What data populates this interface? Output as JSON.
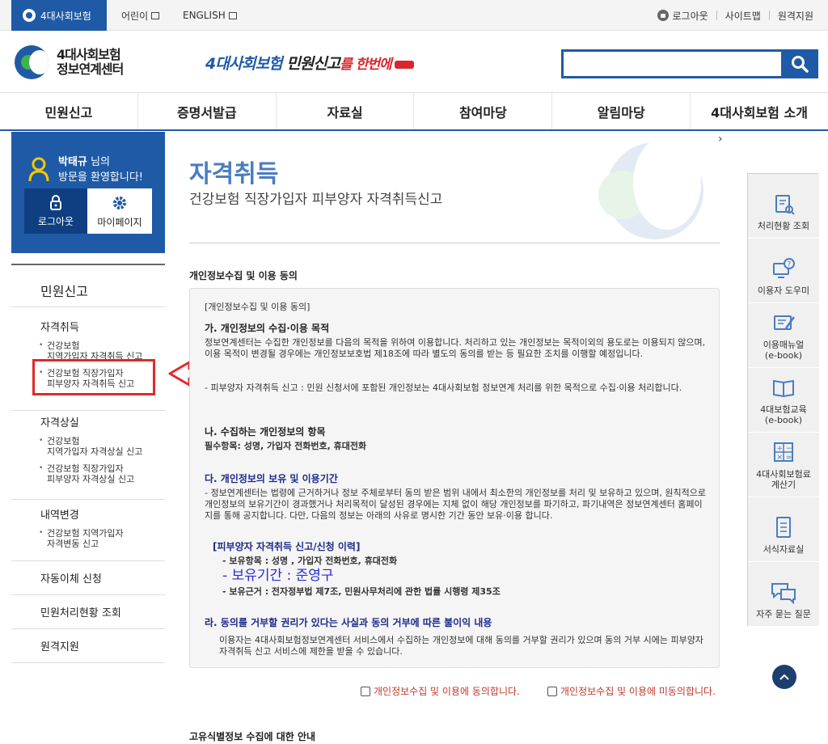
{
  "topbar": {
    "main_tab": "4대사회보험",
    "kids_link": "어린이",
    "english_link": "ENGLISH",
    "logout": "로그아웃",
    "sitemap": "사이트맵",
    "remote": "원격지원"
  },
  "header": {
    "brand_line1": "4대사회보험",
    "brand_line2": "정보연계센터",
    "slogan_part1": "4대사회보험",
    "slogan_part2": " 민원신고",
    "slogan_part3": "를 한번에",
    "search_placeholder": ""
  },
  "gnb": {
    "items": [
      "민원신고",
      "증명서발급",
      "자료실",
      "참여마당",
      "알림마당",
      "4대사회보험 소개"
    ]
  },
  "welcome": {
    "user_name": "박태규",
    "suffix": " 님의",
    "line2": "방문을 환영합니다!",
    "logout_btn": "로그아웃",
    "mypage_btn": "마이페이지"
  },
  "lnb": {
    "title": "민원신고",
    "groups": [
      {
        "title": "자격취득",
        "subs": [
          {
            "l1": "건강보험",
            "l2": "지역가입자 자격취득 신고"
          },
          {
            "l1": "건강보험 직장가입자",
            "l2": "피부양자 자격취득 신고"
          }
        ]
      },
      {
        "title": "자격상실",
        "subs": [
          {
            "l1": "건강보험",
            "l2": "지역가입자 자격상실 신고"
          },
          {
            "l1": "건강보험 직장가입자",
            "l2": "피부양자 자격상실 신고"
          }
        ]
      },
      {
        "title": "내역변경",
        "subs": [
          {
            "l1": "건강보험 지역가입자",
            "l2": "자격변동 신고"
          }
        ]
      }
    ],
    "flat": [
      "자동이체 신청",
      "민원처리현황 조회",
      "원격지원"
    ]
  },
  "content": {
    "title": "자격취득",
    "subtitle": "건강보험 직장가입자 피부양자 자격취득신고",
    "section1": "개인정보수집 및 이용 동의",
    "box_header": "[개인정보수집 및 이용 동의]",
    "ga_title": "가. 개인정보의 수집·이용 목적",
    "ga_body": "정보연계센터는 수집한 개인정보를 다음의 목적을 위하여 이용합니다. 처리하고 있는 개인정보는 목적이외의 용도로는 이용되지 않으며, 이용 목적이 변경될 경우에는 개인정보보호법 제18조에 따라 별도의 동의를 받는 등 필요한 조치를 이행할 예정입니다.",
    "ga_item": "- 피부양자 자격취득 신고 : 민원 신청서에 포함된 개인정보는 4대사회보험 정보연계 처리를 위한 목적으로 수집·이용 처리합니다.",
    "na_title": "나. 수집하는 개인정보의 항목",
    "na_body": "필수항목: 성명, 가입자 전화번호, 휴대전화",
    "da_title": "다. 개인정보의 보유 및 이용기간",
    "da_body": "- 정보연계센터는 법령에 근거하거나 정보 주체로부터 동의 받은 범위 내에서 최소한의 개인정보를 처리 및 보유하고 있으며, 원칙적으로 개인정보의 보유기간이 경과했거나 처리목적이 달성된 경우에는 지체 없이 해당 개인정보를 파기하고, 파기내역은 정보연계센터 홈페이지를 통해 공지합니다. 다만, 다음의 정보는 아래의 사유로 명시한 기간 동안 보유·이용 합니다.",
    "record_title": "[피부양자 자격취득 신고/신청 이력]",
    "record_item1": "- 보유항목 : 성명 , 가입자 전화번호, 휴대전화",
    "record_item2": "- 보유기간 : 준영구",
    "record_item3": "- 보유근거 : 전자정부법 제7조, 민원사무처리에 관한 법률 시행령 제35조",
    "ra_title": "라. 동의를 거부할 권리가 있다는 사실과 동의 거부에 따른 불이익 내용",
    "ra_body": "이용자는 4대사회보험정보연계센터 서비스에서 수집하는 개인정보에 대해 동의를 거부할 권리가 있으며 동의 거부 시에는 피부양자 자격취득 신고 서비스에 제한을 받을 수 있습니다.",
    "agree_label": "개인정보수집 및 이용에 동의합니다.",
    "disagree_label": "개인정보수집 및 이용에 미동의합니다.",
    "section2": "고유식별정보 수집에 대한 안내"
  },
  "quick": {
    "items": [
      {
        "label": "처리현황 조회",
        "icon": "clipboard-search-icon"
      },
      {
        "label": "이용자 도우미",
        "icon": "help-monitor-icon"
      },
      {
        "label": "이용매뉴얼\n(e-book)",
        "icon": "manual-edit-icon"
      },
      {
        "label": "4대보험교육\n(e-book)",
        "icon": "book-icon"
      },
      {
        "label": "4대사회보험료\n계산기",
        "icon": "calculator-icon"
      },
      {
        "label": "서식자료실",
        "icon": "document-icon"
      },
      {
        "label": "자주 묻는 질문",
        "icon": "faq-bubble-icon"
      }
    ]
  },
  "colors": {
    "brand_blue": "#1f5aa6",
    "highlight_red": "#e12a2a",
    "title_blue": "#4a7dc0"
  }
}
